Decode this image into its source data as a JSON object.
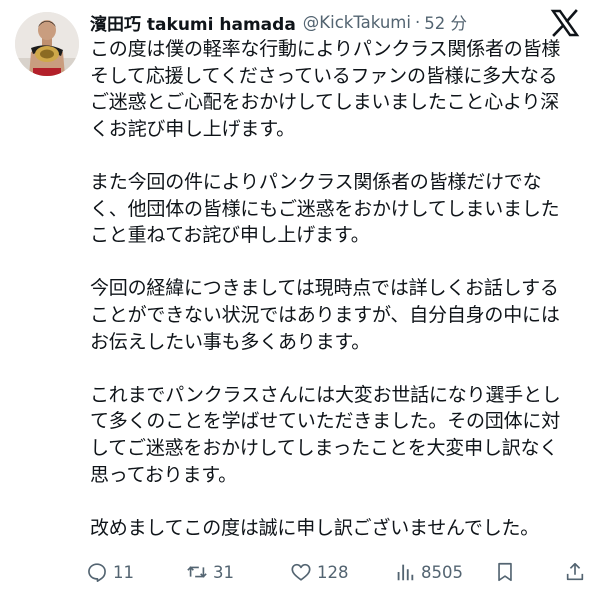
{
  "author": {
    "display_name": "濱田巧 takumi hamada",
    "handle": "@KickTakumi",
    "separator": "·",
    "time": "52 分",
    "avatar_icon": "fighter-with-championship-belt-avatar"
  },
  "brand": {
    "logo": "x-logo-icon",
    "color": "#0f1419"
  },
  "tweet": {
    "paragraphs": [
      [
        "この度は僕の軽率な行動によりパンクラス関係者の皆様",
        "そして応援してくださっているファンの皆様に多大なる",
        "ご迷惑とご心配をおかけしてしまいましたこと心より深",
        "くお詫び申し上げます。"
      ],
      [
        "また今回の件によりパンクラス関係者の皆様だけでな",
        "く、他団体の皆様にもご迷惑をおかけしてしまいました",
        "こと重ねてお詫び申し上げます。"
      ],
      [
        "今回の経緯につきましては現時点では詳しくお話しする",
        "ことができない状況ではありますが、自分自身の中には",
        "お伝えしたい事も多くあります。"
      ],
      [
        "これまでパンクラスさんには大変お世話になり選手とし",
        "て多くのことを学ばせていただきました。その団体に対",
        "してご迷惑をおかけしてしまったことを大変申し訳なく",
        "思っております。"
      ],
      [
        "改めましてこの度は誠に申し訳ございませんでした。"
      ]
    ]
  },
  "actions": {
    "reply": {
      "icon": "reply-icon",
      "count": "11"
    },
    "repost": {
      "icon": "repost-icon",
      "count": "31"
    },
    "like": {
      "icon": "heart-icon",
      "count": "128"
    },
    "views": {
      "icon": "views-chart-icon",
      "count": "8505"
    },
    "bookmark": {
      "icon": "bookmark-icon"
    },
    "share": {
      "icon": "share-icon"
    }
  },
  "colors": {
    "text": "#0f1419",
    "secondary": "#536471",
    "background": "#ffffff"
  }
}
